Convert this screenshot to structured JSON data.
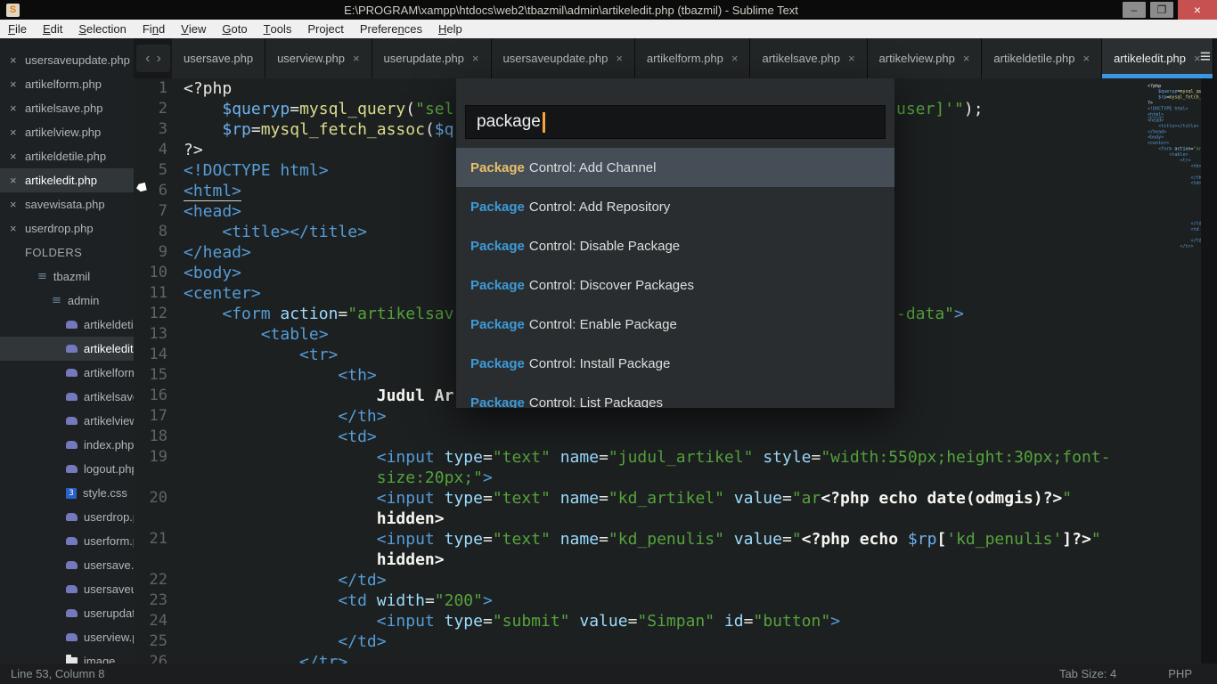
{
  "window": {
    "title": "E:\\PROGRAM\\xampp\\htdocs\\web2\\tbazmil\\admin\\artikeledit.php (tbazmil) - Sublime Text",
    "app_initial": "S",
    "minimize_glyph": "–",
    "restore_glyph": "❐",
    "close_glyph": "×"
  },
  "menu": {
    "items": [
      {
        "label": "File",
        "u": 0
      },
      {
        "label": "Edit",
        "u": 0
      },
      {
        "label": "Selection",
        "u": 0
      },
      {
        "label": "Find",
        "u": 2
      },
      {
        "label": "View",
        "u": 0
      },
      {
        "label": "Goto",
        "u": 0
      },
      {
        "label": "Tools",
        "u": 0
      },
      {
        "label": "Project",
        "u": -1
      },
      {
        "label": "Preferences",
        "u": 7
      },
      {
        "label": "Help",
        "u": 0
      }
    ]
  },
  "sidebar": {
    "open_files": [
      {
        "label": "usersaveupdate.php",
        "selected": false
      },
      {
        "label": "artikelform.php",
        "selected": false
      },
      {
        "label": "artikelsave.php",
        "selected": false
      },
      {
        "label": "artikelview.php",
        "selected": false
      },
      {
        "label": "artikeldetile.php",
        "selected": false
      },
      {
        "label": "artikeledit.php",
        "selected": true
      },
      {
        "label": "savewisata.php",
        "selected": false
      },
      {
        "label": "userdrop.php",
        "selected": false
      }
    ],
    "folders_label": "FOLDERS",
    "close_glyph": "×",
    "tree": [
      {
        "label": "tbazmil",
        "type": "folder-open",
        "depth": 0,
        "selected": false
      },
      {
        "label": "admin",
        "type": "folder-open",
        "depth": 1,
        "selected": false
      },
      {
        "label": "artikeldetile.php",
        "type": "php",
        "depth": 2,
        "selected": false
      },
      {
        "label": "artikeledit.php",
        "type": "php",
        "depth": 2,
        "selected": true
      },
      {
        "label": "artikelform.php",
        "type": "php",
        "depth": 2,
        "selected": false
      },
      {
        "label": "artikelsave.php",
        "type": "php",
        "depth": 2,
        "selected": false
      },
      {
        "label": "artikelview.php",
        "type": "php",
        "depth": 2,
        "selected": false
      },
      {
        "label": "index.php",
        "type": "php",
        "depth": 2,
        "selected": false
      },
      {
        "label": "logout.php",
        "type": "php",
        "depth": 2,
        "selected": false
      },
      {
        "label": "style.css",
        "type": "css",
        "depth": 2,
        "selected": false
      },
      {
        "label": "userdrop.php",
        "type": "php",
        "depth": 2,
        "selected": false
      },
      {
        "label": "userform.php",
        "type": "php",
        "depth": 2,
        "selected": false
      },
      {
        "label": "usersave.php",
        "type": "php",
        "depth": 2,
        "selected": false
      },
      {
        "label": "usersaveupdate.php",
        "type": "php",
        "depth": 2,
        "selected": false
      },
      {
        "label": "userupdate.php",
        "type": "php",
        "depth": 2,
        "selected": false
      },
      {
        "label": "userview.php",
        "type": "php",
        "depth": 2,
        "selected": false
      },
      {
        "label": "image",
        "type": "folder",
        "depth": 2,
        "selected": false
      }
    ]
  },
  "tabbar": {
    "nav_left": "‹",
    "nav_right": "›",
    "overflow_glyph": "≡",
    "close_glyph": "×",
    "tabs": [
      {
        "label": "usersave.php",
        "close": false,
        "active": false
      },
      {
        "label": "userview.php",
        "close": true,
        "active": false
      },
      {
        "label": "userupdate.php",
        "close": true,
        "active": false
      },
      {
        "label": "usersaveupdate.php",
        "close": true,
        "active": false
      },
      {
        "label": "artikelform.php",
        "close": true,
        "active": false
      },
      {
        "label": "artikelsave.php",
        "close": true,
        "active": false
      },
      {
        "label": "artikelview.php",
        "close": true,
        "active": false
      },
      {
        "label": "artikeldetile.php",
        "close": true,
        "active": false
      },
      {
        "label": "artikeledit.php",
        "close": true,
        "active": true
      }
    ]
  },
  "editor": {
    "lines": [
      {
        "n": "1",
        "ind": 0,
        "tokens": [
          [
            "<?php",
            "p"
          ]
        ]
      },
      {
        "n": "2",
        "ind": 4,
        "tokens": [
          [
            "$queryp",
            "v"
          ],
          [
            "=",
            "p"
          ],
          [
            "mysql_query",
            "f"
          ],
          [
            "(",
            "p"
          ],
          [
            "\"sel",
            "s"
          ]
        ],
        "tail": [
          [
            "user]'\"",
            "s"
          ],
          [
            ");",
            "p"
          ]
        ]
      },
      {
        "n": "3",
        "ind": 4,
        "tokens": [
          [
            "$rp",
            "v"
          ],
          [
            "=",
            "p"
          ],
          [
            "mysql_fetch_assoc",
            "f"
          ],
          [
            "(",
            "p"
          ],
          [
            "$q",
            "v"
          ]
        ]
      },
      {
        "n": "4",
        "ind": 0,
        "tokens": [
          [
            "?>",
            "p"
          ]
        ]
      },
      {
        "n": "5",
        "ind": 0,
        "tokens": [
          [
            "<!DOCTYPE html>",
            "t"
          ]
        ]
      },
      {
        "n": "6",
        "ind": 0,
        "tokens": [
          [
            "<html>",
            "tu"
          ]
        ]
      },
      {
        "n": "7",
        "ind": 0,
        "tokens": [
          [
            "<head>",
            "t"
          ]
        ]
      },
      {
        "n": "8",
        "ind": 4,
        "tokens": [
          [
            "<title></title>",
            "t"
          ]
        ]
      },
      {
        "n": "9",
        "ind": 0,
        "tokens": [
          [
            "</head>",
            "t"
          ]
        ]
      },
      {
        "n": "10",
        "ind": 0,
        "tokens": [
          [
            "<body>",
            "t"
          ]
        ]
      },
      {
        "n": "11",
        "ind": 0,
        "tokens": [
          [
            "<center>",
            "t"
          ]
        ]
      },
      {
        "n": "12",
        "ind": 4,
        "tokens": [
          [
            "<form",
            "t"
          ],
          [
            " ",
            "p"
          ],
          [
            "action",
            "a"
          ],
          [
            "=",
            "p"
          ],
          [
            "\"artikelsav",
            "s"
          ]
        ],
        "tail": [
          [
            "-data\"",
            "s"
          ],
          [
            ">",
            "t"
          ]
        ]
      },
      {
        "n": "13",
        "ind": 8,
        "tokens": [
          [
            "<table>",
            "t"
          ]
        ]
      },
      {
        "n": "14",
        "ind": 12,
        "tokens": [
          [
            "<tr>",
            "t"
          ]
        ]
      },
      {
        "n": "15",
        "ind": 16,
        "tokens": [
          [
            "<th>",
            "t"
          ]
        ]
      },
      {
        "n": "16",
        "ind": 20,
        "tokens": [
          [
            "Judul Ar",
            "b"
          ]
        ]
      },
      {
        "n": "17",
        "ind": 16,
        "tokens": [
          [
            "</th>",
            "t"
          ]
        ]
      },
      {
        "n": "18",
        "ind": 16,
        "tokens": [
          [
            "<td>",
            "t"
          ]
        ]
      },
      {
        "n": "19",
        "ind": 20,
        "tokens": [
          [
            "<input",
            "t"
          ],
          [
            " ",
            "p"
          ],
          [
            "type",
            "a"
          ],
          [
            "=",
            "p"
          ],
          [
            "\"text\"",
            "s"
          ],
          [
            " ",
            "p"
          ],
          [
            "name",
            "a"
          ],
          [
            "=",
            "p"
          ],
          [
            "\"judul_artikel\"",
            "s"
          ],
          [
            " ",
            "p"
          ],
          [
            "style",
            "a"
          ],
          [
            "=",
            "p"
          ],
          [
            "\"width:550px;height:30px;font-",
            "s"
          ]
        ]
      },
      {
        "n": "",
        "ind": 20,
        "tokens": [
          [
            "size:20px;\"",
            "s"
          ],
          [
            ">",
            "t"
          ]
        ]
      },
      {
        "n": "20",
        "ind": 20,
        "tokens": [
          [
            "<input",
            "t"
          ],
          [
            " ",
            "p"
          ],
          [
            "type",
            "a"
          ],
          [
            "=",
            "p"
          ],
          [
            "\"text\"",
            "s"
          ],
          [
            " ",
            "p"
          ],
          [
            "name",
            "a"
          ],
          [
            "=",
            "p"
          ],
          [
            "\"kd_artikel\"",
            "s"
          ],
          [
            " ",
            "p"
          ],
          [
            "value",
            "a"
          ],
          [
            "=",
            "p"
          ],
          [
            "\"ar",
            "s"
          ],
          [
            "<?php echo date(odmgis)?>",
            "b"
          ],
          [
            "\"",
            "s"
          ]
        ]
      },
      {
        "n": "",
        "ind": 20,
        "tokens": [
          [
            "hidden>",
            "b"
          ]
        ]
      },
      {
        "n": "21",
        "ind": 20,
        "tokens": [
          [
            "<input",
            "t"
          ],
          [
            " ",
            "p"
          ],
          [
            "type",
            "a"
          ],
          [
            "=",
            "p"
          ],
          [
            "\"text\"",
            "s"
          ],
          [
            " ",
            "p"
          ],
          [
            "name",
            "a"
          ],
          [
            "=",
            "p"
          ],
          [
            "\"kd_penulis\"",
            "s"
          ],
          [
            " ",
            "p"
          ],
          [
            "value",
            "a"
          ],
          [
            "=",
            "p"
          ],
          [
            "\"",
            "s"
          ],
          [
            "<?php echo ",
            "b"
          ],
          [
            "$rp",
            "v"
          ],
          [
            "[",
            "b"
          ],
          [
            "'kd_penulis'",
            "s"
          ],
          [
            "]?>",
            "b"
          ],
          [
            "\"",
            "s"
          ]
        ]
      },
      {
        "n": "",
        "ind": 20,
        "tokens": [
          [
            "hidden>",
            "b"
          ]
        ]
      },
      {
        "n": "22",
        "ind": 16,
        "tokens": [
          [
            "</td>",
            "t"
          ]
        ]
      },
      {
        "n": "23",
        "ind": 16,
        "tokens": [
          [
            "<td",
            "t"
          ],
          [
            " ",
            "p"
          ],
          [
            "width",
            "a"
          ],
          [
            "=",
            "p"
          ],
          [
            "\"200\"",
            "s"
          ],
          [
            ">",
            "t"
          ]
        ]
      },
      {
        "n": "24",
        "ind": 20,
        "tokens": [
          [
            "<input",
            "t"
          ],
          [
            " ",
            "p"
          ],
          [
            "type",
            "a"
          ],
          [
            "=",
            "p"
          ],
          [
            "\"submit\"",
            "s"
          ],
          [
            " ",
            "p"
          ],
          [
            "value",
            "a"
          ],
          [
            "=",
            "p"
          ],
          [
            "\"Simpan\"",
            "s"
          ],
          [
            " ",
            "p"
          ],
          [
            "id",
            "a"
          ],
          [
            "=",
            "p"
          ],
          [
            "\"button\"",
            "s"
          ],
          [
            ">",
            "t"
          ]
        ]
      },
      {
        "n": "25",
        "ind": 16,
        "tokens": [
          [
            "</td>",
            "t"
          ]
        ]
      },
      {
        "n": "26",
        "ind": 12,
        "tokens": [
          [
            "</tr>",
            "t"
          ]
        ]
      }
    ]
  },
  "palette": {
    "query": "package",
    "items": [
      {
        "prefix": "Package",
        "rest": " Control: Add Channel",
        "selected": true
      },
      {
        "prefix": "Package",
        "rest": " Control: Add Repository",
        "selected": false
      },
      {
        "prefix": "Package",
        "rest": " Control: Disable Package",
        "selected": false
      },
      {
        "prefix": "Package",
        "rest": " Control: Discover Packages",
        "selected": false
      },
      {
        "prefix": "Package",
        "rest": " Control: Enable Package",
        "selected": false
      },
      {
        "prefix": "Package",
        "rest": " Control: Install Package",
        "selected": false
      },
      {
        "prefix": "Package",
        "rest": " Control: List Packages",
        "selected": false
      }
    ]
  },
  "status": {
    "left": "Line 53, Column 8",
    "tab_size": "Tab Size: 4",
    "syntax": "PHP"
  },
  "colors": {
    "accent_blue": "#3b97e3",
    "close_red": "#c75050",
    "prefix_blue": "#3d9bd9",
    "prefix_gold": "#e8c06a",
    "string_green": "#55a33c",
    "tag_blue": "#569cd6",
    "attr_cyan": "#9cdcfe",
    "func_yellow": "#dcdc8b",
    "editor_bg": "#1d2021",
    "sidebar_bg": "#1e2123"
  }
}
